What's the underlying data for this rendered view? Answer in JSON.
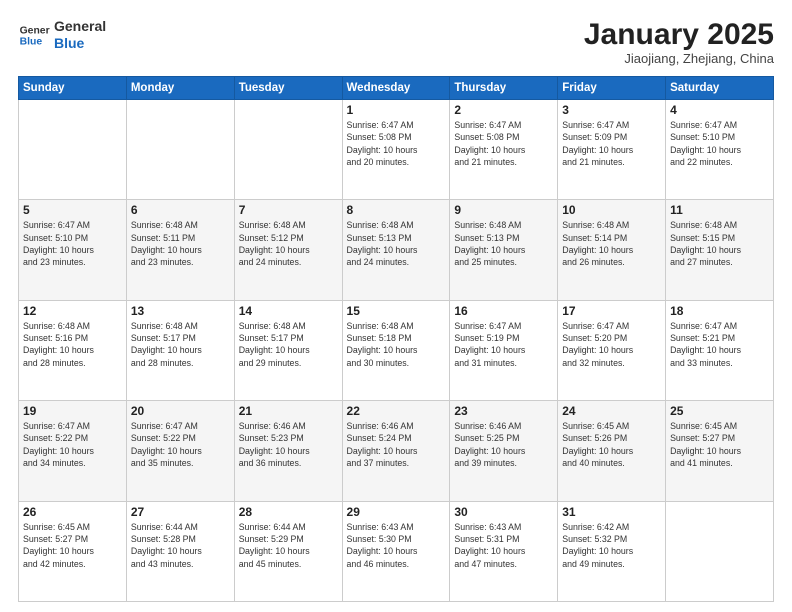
{
  "logo": {
    "line1": "General",
    "line2": "Blue"
  },
  "title": "January 2025",
  "location": "Jiaojiang, Zhejiang, China",
  "days_of_week": [
    "Sunday",
    "Monday",
    "Tuesday",
    "Wednesday",
    "Thursday",
    "Friday",
    "Saturday"
  ],
  "weeks": [
    [
      {
        "day": "",
        "info": ""
      },
      {
        "day": "",
        "info": ""
      },
      {
        "day": "",
        "info": ""
      },
      {
        "day": "1",
        "info": "Sunrise: 6:47 AM\nSunset: 5:08 PM\nDaylight: 10 hours\nand 20 minutes."
      },
      {
        "day": "2",
        "info": "Sunrise: 6:47 AM\nSunset: 5:08 PM\nDaylight: 10 hours\nand 21 minutes."
      },
      {
        "day": "3",
        "info": "Sunrise: 6:47 AM\nSunset: 5:09 PM\nDaylight: 10 hours\nand 21 minutes."
      },
      {
        "day": "4",
        "info": "Sunrise: 6:47 AM\nSunset: 5:10 PM\nDaylight: 10 hours\nand 22 minutes."
      }
    ],
    [
      {
        "day": "5",
        "info": "Sunrise: 6:47 AM\nSunset: 5:10 PM\nDaylight: 10 hours\nand 23 minutes."
      },
      {
        "day": "6",
        "info": "Sunrise: 6:48 AM\nSunset: 5:11 PM\nDaylight: 10 hours\nand 23 minutes."
      },
      {
        "day": "7",
        "info": "Sunrise: 6:48 AM\nSunset: 5:12 PM\nDaylight: 10 hours\nand 24 minutes."
      },
      {
        "day": "8",
        "info": "Sunrise: 6:48 AM\nSunset: 5:13 PM\nDaylight: 10 hours\nand 24 minutes."
      },
      {
        "day": "9",
        "info": "Sunrise: 6:48 AM\nSunset: 5:13 PM\nDaylight: 10 hours\nand 25 minutes."
      },
      {
        "day": "10",
        "info": "Sunrise: 6:48 AM\nSunset: 5:14 PM\nDaylight: 10 hours\nand 26 minutes."
      },
      {
        "day": "11",
        "info": "Sunrise: 6:48 AM\nSunset: 5:15 PM\nDaylight: 10 hours\nand 27 minutes."
      }
    ],
    [
      {
        "day": "12",
        "info": "Sunrise: 6:48 AM\nSunset: 5:16 PM\nDaylight: 10 hours\nand 28 minutes."
      },
      {
        "day": "13",
        "info": "Sunrise: 6:48 AM\nSunset: 5:17 PM\nDaylight: 10 hours\nand 28 minutes."
      },
      {
        "day": "14",
        "info": "Sunrise: 6:48 AM\nSunset: 5:17 PM\nDaylight: 10 hours\nand 29 minutes."
      },
      {
        "day": "15",
        "info": "Sunrise: 6:48 AM\nSunset: 5:18 PM\nDaylight: 10 hours\nand 30 minutes."
      },
      {
        "day": "16",
        "info": "Sunrise: 6:47 AM\nSunset: 5:19 PM\nDaylight: 10 hours\nand 31 minutes."
      },
      {
        "day": "17",
        "info": "Sunrise: 6:47 AM\nSunset: 5:20 PM\nDaylight: 10 hours\nand 32 minutes."
      },
      {
        "day": "18",
        "info": "Sunrise: 6:47 AM\nSunset: 5:21 PM\nDaylight: 10 hours\nand 33 minutes."
      }
    ],
    [
      {
        "day": "19",
        "info": "Sunrise: 6:47 AM\nSunset: 5:22 PM\nDaylight: 10 hours\nand 34 minutes."
      },
      {
        "day": "20",
        "info": "Sunrise: 6:47 AM\nSunset: 5:22 PM\nDaylight: 10 hours\nand 35 minutes."
      },
      {
        "day": "21",
        "info": "Sunrise: 6:46 AM\nSunset: 5:23 PM\nDaylight: 10 hours\nand 36 minutes."
      },
      {
        "day": "22",
        "info": "Sunrise: 6:46 AM\nSunset: 5:24 PM\nDaylight: 10 hours\nand 37 minutes."
      },
      {
        "day": "23",
        "info": "Sunrise: 6:46 AM\nSunset: 5:25 PM\nDaylight: 10 hours\nand 39 minutes."
      },
      {
        "day": "24",
        "info": "Sunrise: 6:45 AM\nSunset: 5:26 PM\nDaylight: 10 hours\nand 40 minutes."
      },
      {
        "day": "25",
        "info": "Sunrise: 6:45 AM\nSunset: 5:27 PM\nDaylight: 10 hours\nand 41 minutes."
      }
    ],
    [
      {
        "day": "26",
        "info": "Sunrise: 6:45 AM\nSunset: 5:27 PM\nDaylight: 10 hours\nand 42 minutes."
      },
      {
        "day": "27",
        "info": "Sunrise: 6:44 AM\nSunset: 5:28 PM\nDaylight: 10 hours\nand 43 minutes."
      },
      {
        "day": "28",
        "info": "Sunrise: 6:44 AM\nSunset: 5:29 PM\nDaylight: 10 hours\nand 45 minutes."
      },
      {
        "day": "29",
        "info": "Sunrise: 6:43 AM\nSunset: 5:30 PM\nDaylight: 10 hours\nand 46 minutes."
      },
      {
        "day": "30",
        "info": "Sunrise: 6:43 AM\nSunset: 5:31 PM\nDaylight: 10 hours\nand 47 minutes."
      },
      {
        "day": "31",
        "info": "Sunrise: 6:42 AM\nSunset: 5:32 PM\nDaylight: 10 hours\nand 49 minutes."
      },
      {
        "day": "",
        "info": ""
      }
    ]
  ]
}
